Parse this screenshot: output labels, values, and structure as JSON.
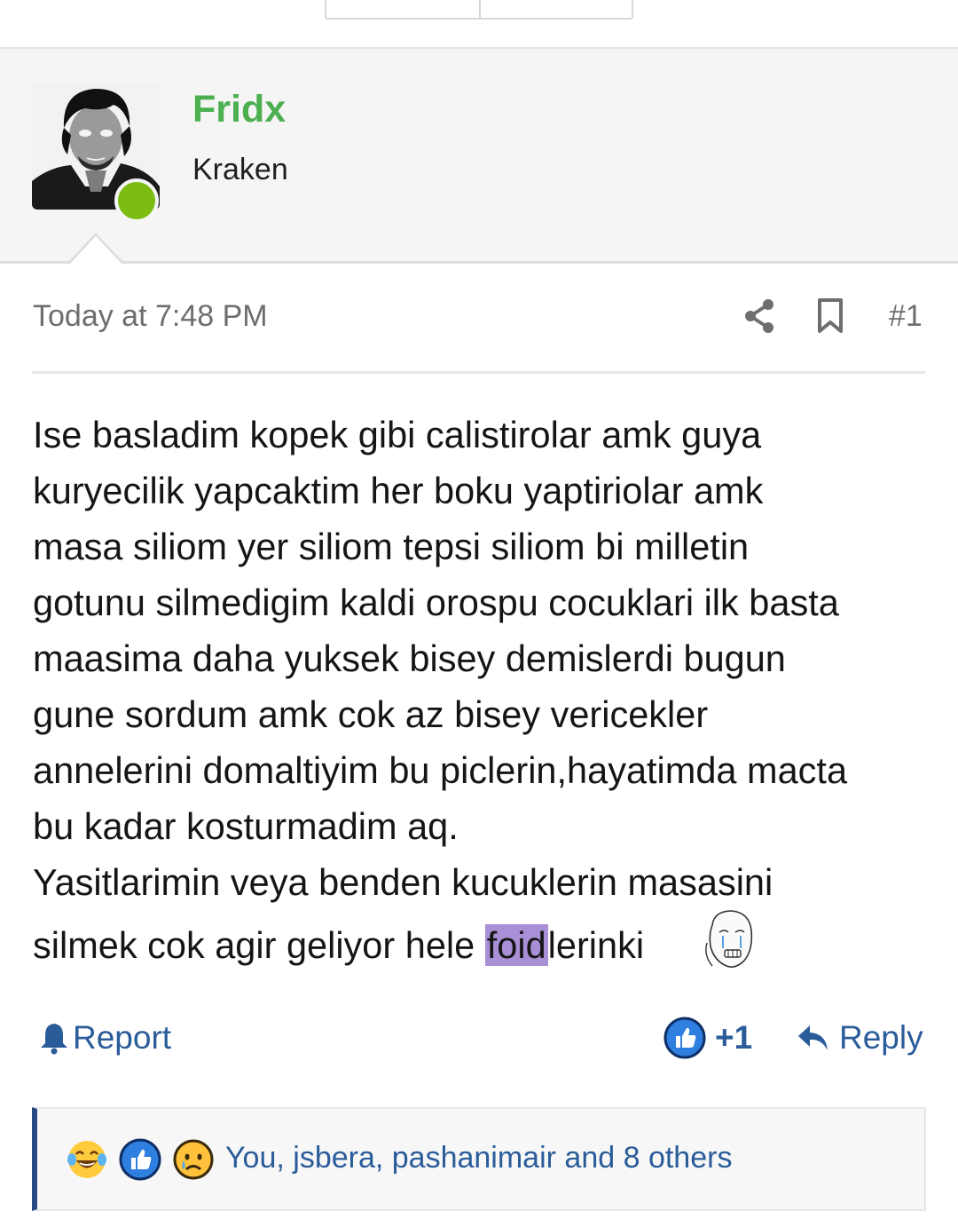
{
  "user": {
    "name": "Fridx",
    "title": "Kraken",
    "online": true
  },
  "post": {
    "date": "Today at 7:48 PM",
    "number": "#1",
    "lines": [
      "Ise basladim kopek gibi calistirolar amk guya",
      "kuryecilik yapcaktim her boku yaptiriolar amk",
      "masa siliom yer siliom tepsi siliom bi milletin",
      "gotunu silmedigim kaldi orospu cocuklari ilk basta",
      "maasima daha yuksek bisey demislerdi bugun",
      "gune sordum amk cok az bisey vericekler",
      "annelerini domaltiyim bu piclerin,hayatimda macta",
      "bu kadar kosturmadim aq.",
      "Yasitlarimin veya benden kucuklerin masasini"
    ],
    "last_line_before": "silmek cok agir geliyor hele ",
    "last_line_highlight": "foid",
    "last_line_after": "lerinki",
    "emoji": "crying-wojak-icon"
  },
  "actions": {
    "report_label": "Report",
    "like_label": "+1",
    "reply_label": "Reply"
  },
  "reactions": {
    "icons": [
      "laughing-tears-icon",
      "thumbs-up-icon",
      "sad-tear-icon"
    ],
    "summary": "You, jsbera, pashanimair and 8 others"
  },
  "colors": {
    "username": "#4caf50",
    "link": "#2a5c9a",
    "online": "#7bbd11",
    "highlight": "#a98fd6",
    "reaction_accent": "#2a4a86"
  }
}
